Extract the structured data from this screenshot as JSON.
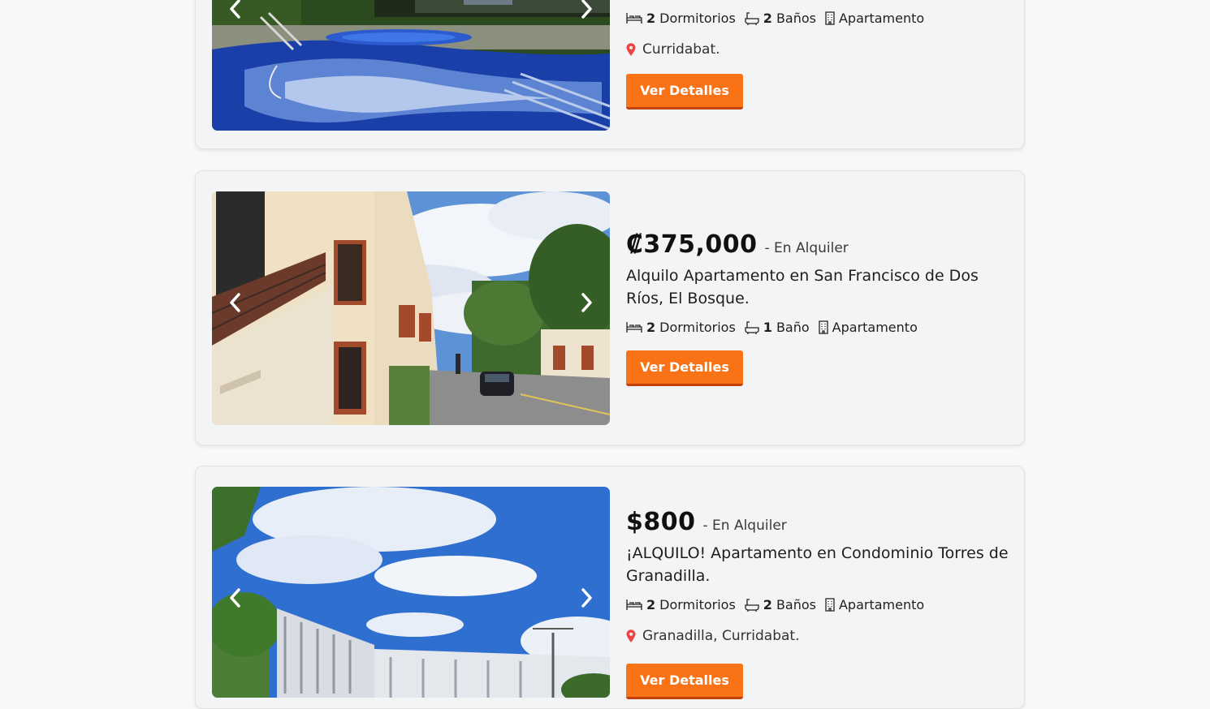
{
  "listings": [
    {
      "price": "",
      "operation": "",
      "title": "",
      "bedrooms": "2",
      "bedrooms_label": "Dormitorios",
      "bathrooms": "2",
      "bathrooms_label": "Baños",
      "type": "Apartamento",
      "location": "Curridabat.",
      "button": "Ver Detalles"
    },
    {
      "price": "₡375,000",
      "operation": "- En Alquiler",
      "title": "Alquilo Apartamento en San Francisco de Dos Ríos, El Bosque.",
      "bedrooms": "2",
      "bedrooms_label": "Dormitorios",
      "bathrooms": "1",
      "bathrooms_label": "Baño",
      "type": "Apartamento",
      "location": "",
      "button": "Ver Detalles"
    },
    {
      "price": "$800",
      "operation": "- En Alquiler",
      "title": "¡ALQUILO! Apartamento en Condominio Torres de Granadilla.",
      "bedrooms": "2",
      "bedrooms_label": "Dormitorios",
      "bathrooms": "2",
      "bathrooms_label": "Baños",
      "type": "Apartamento",
      "location": "Granadilla, Curridabat.",
      "button": "Ver Detalles"
    }
  ],
  "icons": {
    "bed": "bed-icon",
    "bath": "bath-icon",
    "building": "building-icon",
    "location": "map-pin-icon",
    "prev": "chevron-left-icon",
    "next": "chevron-right-icon"
  },
  "colors": {
    "accent": "#f97316",
    "accent_dark": "#c2410c",
    "pin": "#ef4444",
    "card_bg": "#f3f4f6"
  }
}
